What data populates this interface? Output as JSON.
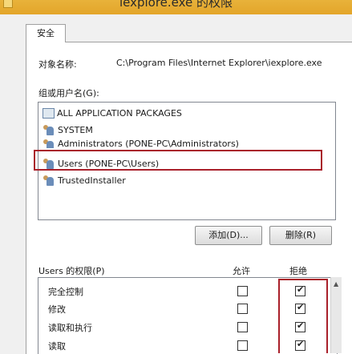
{
  "window": {
    "title": "iexplore.exe 的权限"
  },
  "tab": {
    "label": "安全"
  },
  "object": {
    "label": "对象名称:",
    "path": "C:\\Program Files\\Internet Explorer\\iexplore.exe"
  },
  "groups": {
    "label": "组或用户名(G):",
    "items": [
      {
        "name": "ALL APPLICATION PACKAGES",
        "icon": "package-icon"
      },
      {
        "name": "SYSTEM",
        "icon": "users-icon"
      },
      {
        "name": "Administrators (PONE-PC\\Administrators)",
        "icon": "users-icon"
      },
      {
        "name": "Users (PONE-PC\\Users)",
        "icon": "users-icon",
        "selected": true
      },
      {
        "name": "TrustedInstaller",
        "icon": "users-icon"
      }
    ]
  },
  "buttons": {
    "add": "添加(D)...",
    "remove": "删除(R)"
  },
  "permissions": {
    "label": "Users 的权限(P)",
    "allow_header": "允许",
    "deny_header": "拒绝",
    "rows": [
      {
        "name": "完全控制",
        "allow": false,
        "deny": true
      },
      {
        "name": "修改",
        "allow": false,
        "deny": true
      },
      {
        "name": "读取和执行",
        "allow": false,
        "deny": true
      },
      {
        "name": "读取",
        "allow": false,
        "deny": true
      }
    ]
  },
  "colors": {
    "highlight_box": "#a9202a",
    "titlebar": "#e3a52a"
  }
}
